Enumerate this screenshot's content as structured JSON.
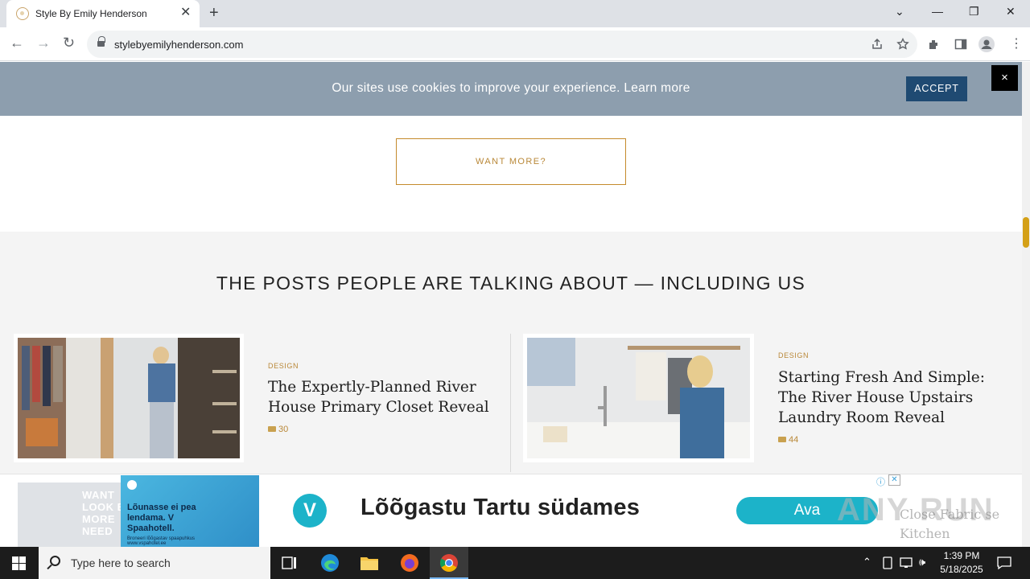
{
  "browser": {
    "tab_title": "Style By Emily Henderson",
    "tab_close": "✕",
    "new_tab": "+",
    "url": "stylebyemilyhenderson.com",
    "window_controls": {
      "dropdown": "⌄",
      "minimize": "—",
      "restore": "❐",
      "close": "✕"
    },
    "nav": {
      "back": "←",
      "forward": "→",
      "reload": "↻"
    }
  },
  "cookie_banner": {
    "message": "Our sites use cookies to improve your experience. Learn more",
    "accept_label": "ACCEPT",
    "close_label": "×",
    "background": "#8d9eae"
  },
  "want_more": {
    "label": "WANT MORE?"
  },
  "section": {
    "heading": "THE POSTS PEOPLE ARE TALKING ABOUT — INCLUDING US",
    "posts": [
      {
        "category": "DESIGN",
        "title": "The Expertly-Planned River House Primary Closet Reveal",
        "comments": "30"
      },
      {
        "category": "DESIGN",
        "title": "Starting Fresh And Simple: The River House Upstairs Laundry Room Reveal",
        "comments": "44"
      }
    ]
  },
  "ad": {
    "left_text": "WANT LOOK BI & MORE NEED",
    "hotel_text": "Lõunasse ei pea lendama. V Spaahotell.",
    "hotel_sub": "Broneeri lõõgastav spaapuhkus www.vspahotel.ee",
    "logo_letter": "V",
    "headline": "Lõõgastu Tartu südames",
    "cta": "Ava",
    "info_icon": "ⓘ",
    "close_icon": "✕",
    "right_text": "Close Fabric se Kitchen",
    "watermark": "ANY RUN"
  },
  "taskbar": {
    "search_placeholder": "Type here to search",
    "time": "1:39 PM",
    "date": "5/18/2025"
  },
  "accent_color": "#b98838"
}
